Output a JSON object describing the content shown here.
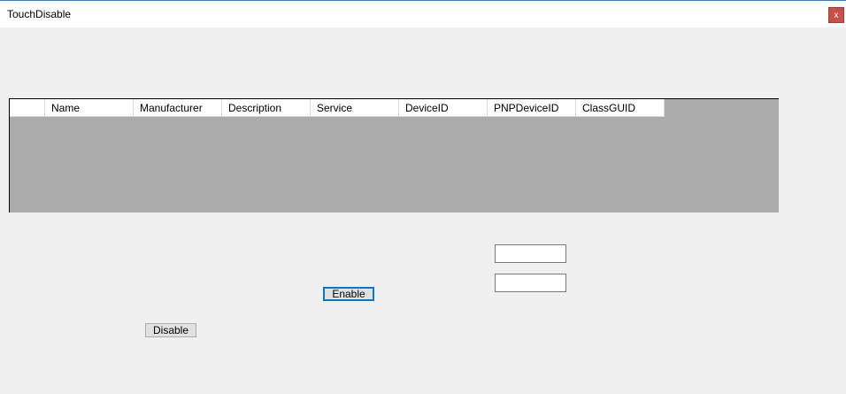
{
  "window": {
    "title": "TouchDisable",
    "close_label": "x"
  },
  "grid": {
    "columns": [
      "Name",
      "Manufacturer",
      "Description",
      "Service",
      "DeviceID",
      "PNPDeviceID",
      "ClassGUID"
    ]
  },
  "inputs": {
    "field1_value": "",
    "field2_value": ""
  },
  "buttons": {
    "enable_label": "Enable",
    "disable_label": "Disable"
  }
}
